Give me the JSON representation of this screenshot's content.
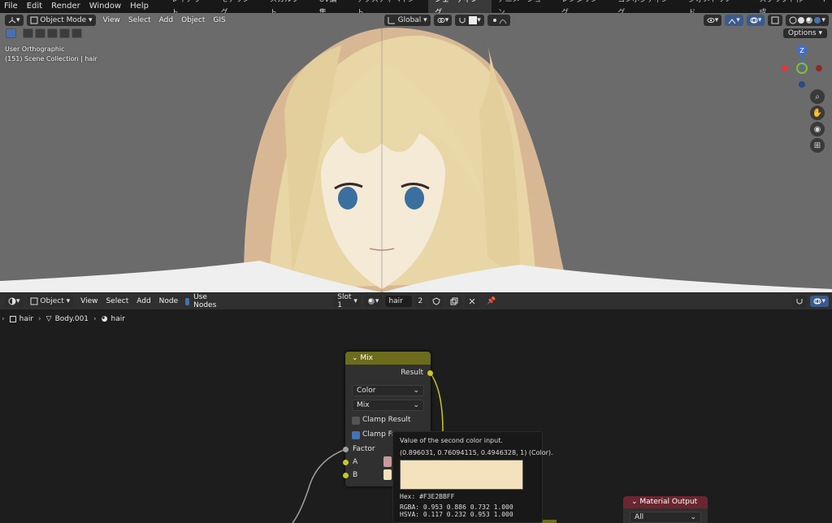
{
  "menubar": {
    "items": [
      "File",
      "Edit",
      "Render",
      "Window",
      "Help"
    ],
    "workspaces": [
      "レイアウト",
      "モデリング",
      "スカルプト",
      "UV編集",
      "テクスチャペイント",
      "シェーディング",
      "アニメーション",
      "レンダリング",
      "コンポジティング",
      "ジオメトリノード",
      "スクリプト作成"
    ],
    "active_workspace": "シェーディング",
    "add_tab": "+"
  },
  "viewport": {
    "mode": "Object Mode",
    "menus": [
      "View",
      "Select",
      "Add",
      "Object",
      "GIS"
    ],
    "transform_orientation": "Global",
    "options_label": "Options",
    "view_name": "User Orthographic",
    "collection_info": "(151) Scene Collection | hair",
    "gizmo_axis": "Z",
    "colors": {
      "background": "#6b6b6b",
      "x_axis": "#d63c3c",
      "y_axis": "#7ac140",
      "z_axis": "#3b6fd6"
    }
  },
  "node_editor": {
    "object_type": "Object",
    "menus": [
      "View",
      "Select",
      "Add",
      "Node"
    ],
    "use_nodes_label": "Use Nodes",
    "use_nodes_checked": true,
    "slot": "Slot 1",
    "material_name": "hair",
    "user_count": "2",
    "breadcrumb": [
      "hair",
      "Body.001",
      "hair"
    ]
  },
  "mix_node": {
    "title": "Mix",
    "output_label": "Result",
    "data_type": "Color",
    "blend_mode": "Mix",
    "clamp_result_label": "Clamp Result",
    "clamp_result_checked": false,
    "clamp_factor_label": "Clamp Fa",
    "clamp_factor_checked": true,
    "inputs": [
      "Factor",
      "A",
      "B"
    ],
    "colors": {
      "header": "#6c6c1c",
      "socket_float": "#a1a1a1",
      "socket_color": "#c7c729",
      "a_color": "#C89A9A",
      "b_color": "#F3E2BB"
    }
  },
  "tooltip": {
    "description": "Value of the second color input.",
    "value": "(0.896031, 0.76094115, 0.4946328, 1) (Color).",
    "hex": "Hex: #F3E2BBFF",
    "rgba": "RGBA:  0.953  0.886  0.732  1.000",
    "hsva": "HSVA:  0.117  0.232  0.953  1.000",
    "swatch_color": "#F3E2BB"
  },
  "material_output_node": {
    "title": "Material Output",
    "target": "All",
    "header_color": "#6b2630"
  }
}
